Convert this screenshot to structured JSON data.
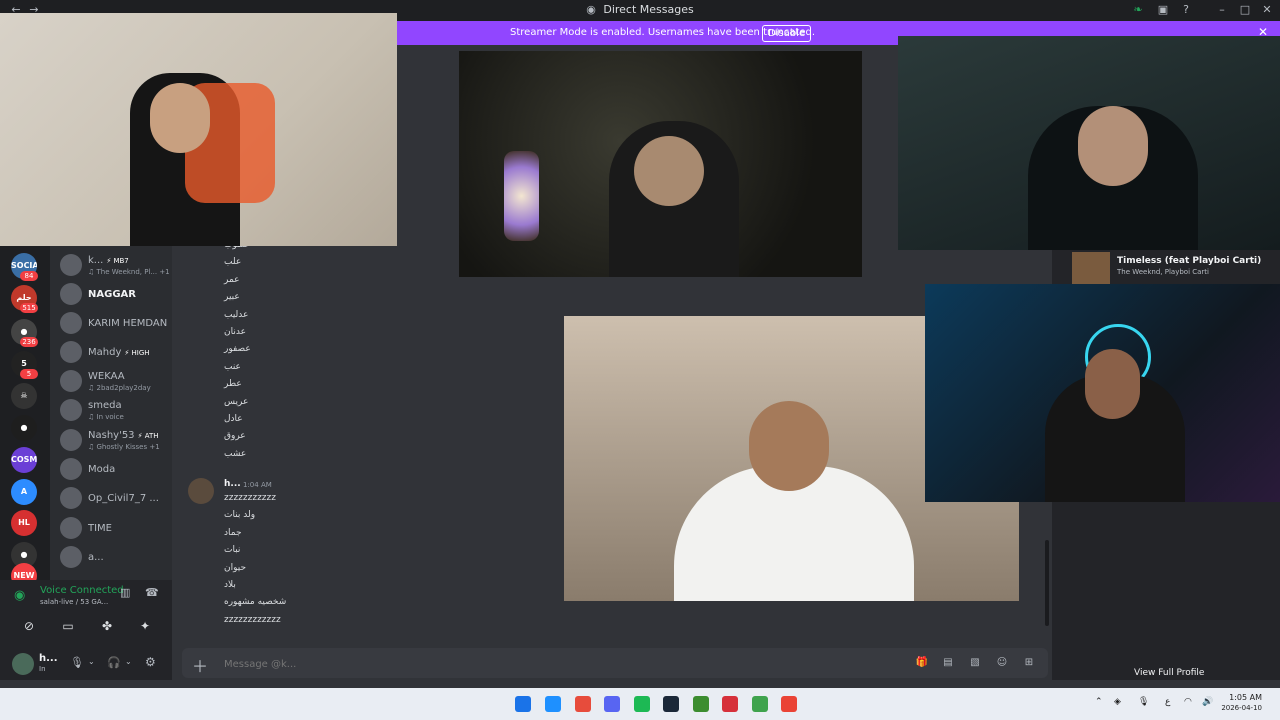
{
  "window": {
    "title": "Direct Messages",
    "back": "←",
    "forward": "→",
    "min": "–",
    "max": "□",
    "close": "✕"
  },
  "banner": {
    "text": "Streamer Mode is enabled. Usernames have been truncated.",
    "button": "Disable",
    "close": "✕"
  },
  "guilds": [
    {
      "label": "SOCIAL",
      "badge": "84",
      "color": "#3a6ea5"
    },
    {
      "label": "حلم",
      "badge": "515",
      "color": "#c0392b"
    },
    {
      "label": "●",
      "badge": "236",
      "color": "#444"
    },
    {
      "label": "5",
      "badge": "5",
      "color": "#222"
    },
    {
      "label": "☠",
      "badge": "",
      "color": "#333"
    },
    {
      "label": "●",
      "badge": "",
      "color": "#1e1e1e"
    },
    {
      "label": "COSMIC",
      "badge": "",
      "color": "#6b3fd6"
    },
    {
      "label": "A",
      "badge": "",
      "color": "#2d8cff"
    },
    {
      "label": "HL",
      "badge": "",
      "color": "#d63031"
    },
    {
      "label": "●",
      "badge": "",
      "color": "#333"
    },
    {
      "label": "NEW",
      "badge": "",
      "color": "#f23f43"
    }
  ],
  "members": [
    {
      "name": "k...",
      "tag": "⚡ MB7",
      "sub": "♫ The Weeknd, Pl... +1",
      "bold": false
    },
    {
      "name": "NAGGAR",
      "tag": "",
      "sub": "",
      "bold": true
    },
    {
      "name": "KARIM HEMDAN",
      "tag": "",
      "sub": "",
      "bold": false
    },
    {
      "name": "Mahdy",
      "tag": "⚡ HIGH",
      "sub": "",
      "bold": false
    },
    {
      "name": "WEKAA",
      "tag": "",
      "sub": "♫ 2bad2play2day",
      "bold": false
    },
    {
      "name": "smeda",
      "tag": "",
      "sub": "♫ In voice",
      "bold": false
    },
    {
      "name": "Nashy'53",
      "tag": "⚡ ATH",
      "sub": "♫ Ghostly Kisses +1",
      "bold": false
    },
    {
      "name": "Moda",
      "tag": "",
      "sub": "",
      "bold": false
    },
    {
      "name": "Op_Civil7_7 ...",
      "tag": "",
      "sub": "",
      "bold": false
    },
    {
      "name": "TIME",
      "tag": "",
      "sub": "",
      "bold": false
    },
    {
      "name": "a...",
      "tag": "",
      "sub": "",
      "bold": false
    }
  ],
  "voice": {
    "title": "Voice Connected",
    "sub": "salah-live / 53 GA...",
    "user": "h...",
    "user_status": "In"
  },
  "chat": {
    "lines_top": [
      "عطوب",
      "علب",
      "عمر",
      "عبير",
      "عدليب",
      "عدنان",
      "عصفور",
      "عنب",
      "عطر",
      "عريس",
      "عادل",
      "عروق",
      "عشب"
    ],
    "author": "h...",
    "time": "1:04 AM",
    "lines_bottom": [
      "zzzzzzzzzzz",
      "ولد بنات",
      "جماد",
      "نبات",
      "حيوان",
      "بلاد",
      "شخصيه مشهوره",
      "zzzzzzzzzzzz"
    ],
    "placeholder": "Message @k..."
  },
  "profile": {
    "song_title": "Timeless (feat Playboi Carti)",
    "song_artist": "The Weeknd, Playboi Carti",
    "view_full": "View Full Profile"
  },
  "taskbar": {
    "time": "1:05 AM",
    "date": "2026-04-10",
    "lang": "ع",
    "apps": [
      "#1e90ff",
      "#e74c3c",
      "#5865f2",
      "#1db954",
      "#1b2838",
      "#3c8d2f",
      "#d6303a",
      "#3fa34d",
      "#ea4335"
    ]
  }
}
